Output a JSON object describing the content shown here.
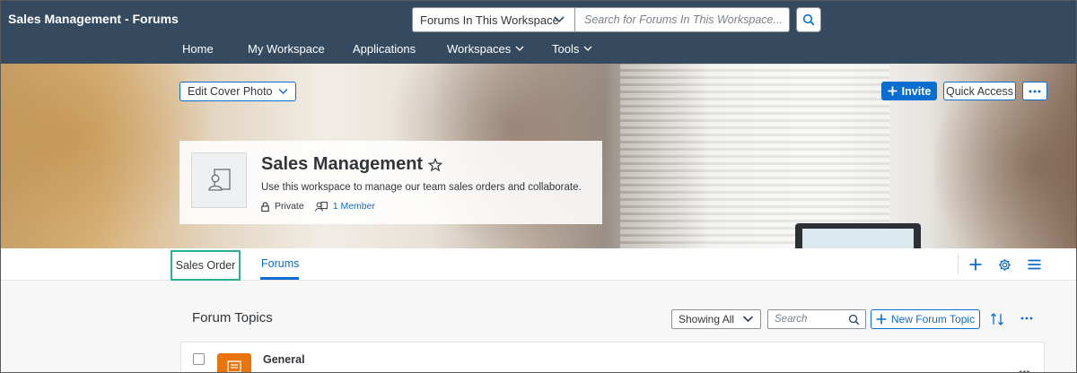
{
  "app": {
    "title": "Sales Management - Forums"
  },
  "header": {
    "scope_value": "Forums In This Workspace",
    "search_placeholder": "Search for Forums In This Workspace...",
    "nav": [
      {
        "label": "Home",
        "has_dropdown": false
      },
      {
        "label": "My Workspace",
        "has_dropdown": false
      },
      {
        "label": "Applications",
        "has_dropdown": false
      },
      {
        "label": "Workspaces",
        "has_dropdown": true
      },
      {
        "label": "Tools",
        "has_dropdown": true
      }
    ]
  },
  "cover": {
    "edit_label": "Edit Cover Photo",
    "invite_label": "Invite",
    "quick_access_label": "Quick Access"
  },
  "workspace": {
    "name": "Sales Management",
    "description": "Use this workspace to manage our team sales orders and collaborate.",
    "privacy": "Private",
    "members": "1 Member"
  },
  "tabs": [
    {
      "label": "Sales Order",
      "active": false,
      "highlighted": true
    },
    {
      "label": "Forums",
      "active": true
    }
  ],
  "content": {
    "section_title": "Forum Topics",
    "filter_value": "Showing All",
    "search_placeholder": "Search",
    "new_topic_label": "New Forum Topic",
    "topics": [
      {
        "title": "General",
        "icon": "forum-topic-icon"
      }
    ]
  },
  "colors": {
    "header_bg": "#354a5f",
    "accent": "#0a6ed1",
    "highlight_border": "#2bb08f",
    "topic_icon_bg": "#e9730c"
  }
}
